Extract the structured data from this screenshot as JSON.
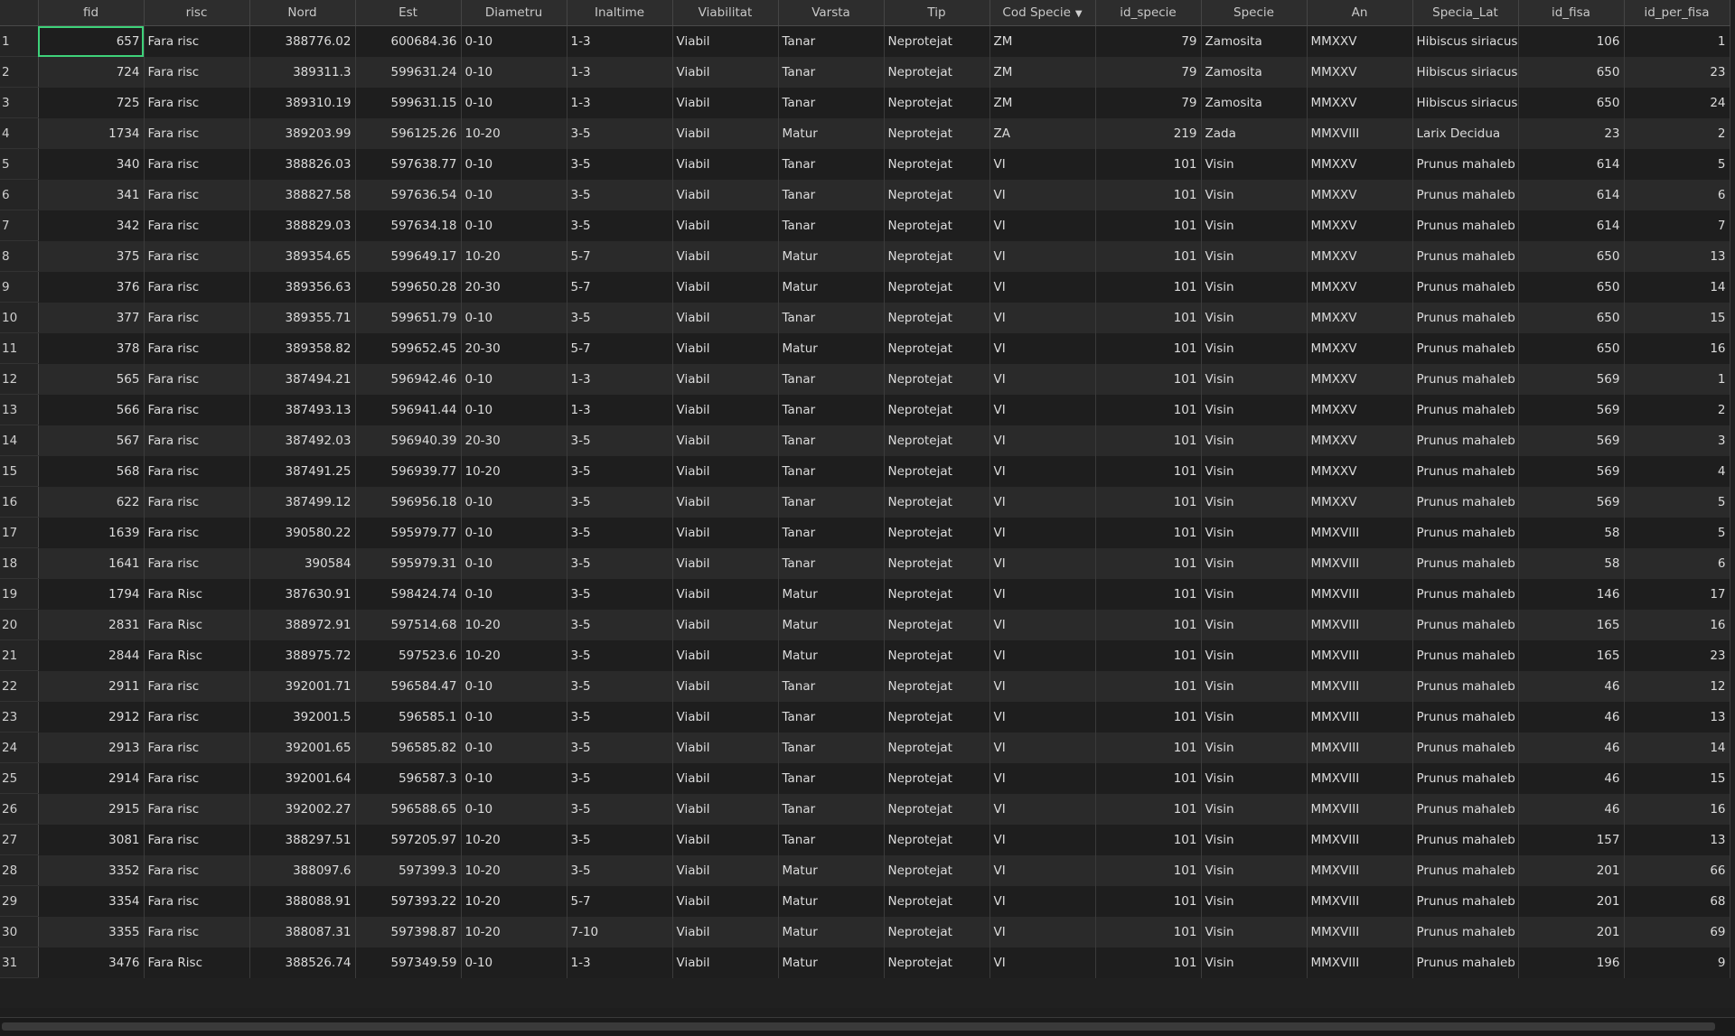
{
  "table": {
    "selected_row": 0,
    "selected_column": "fid",
    "columns": [
      {
        "key": "fid",
        "label": "fid",
        "align": "num"
      },
      {
        "key": "risc",
        "label": "risc",
        "align": "txt"
      },
      {
        "key": "nord",
        "label": "Nord",
        "align": "num"
      },
      {
        "key": "est",
        "label": "Est",
        "align": "num"
      },
      {
        "key": "diametru",
        "label": "Diametru",
        "align": "txt"
      },
      {
        "key": "inaltime",
        "label": "Inaltime",
        "align": "txt"
      },
      {
        "key": "viabilitat",
        "label": "Viabilitat",
        "align": "txt"
      },
      {
        "key": "varsta",
        "label": "Varsta",
        "align": "txt"
      },
      {
        "key": "tip",
        "label": "Tip",
        "align": "txt"
      },
      {
        "key": "cod_specie",
        "label": "Cod Specie",
        "align": "txt",
        "sorted": "desc"
      },
      {
        "key": "id_specie",
        "label": "id_specie",
        "align": "num"
      },
      {
        "key": "specie",
        "label": "Specie",
        "align": "txt"
      },
      {
        "key": "an",
        "label": "An",
        "align": "txt"
      },
      {
        "key": "specia_lat",
        "label": "Specia_Lat",
        "align": "txt"
      },
      {
        "key": "id_fisa",
        "label": "id_fisa",
        "align": "num"
      },
      {
        "key": "id_per_fisa",
        "label": "id_per_fisa",
        "align": "num"
      }
    ],
    "rows": [
      [
        "1",
        "657",
        "Fara risc",
        "388776.02",
        "600684.36",
        "0-10",
        "1-3",
        "Viabil",
        "Tanar",
        "Neprotejat",
        "ZM",
        "79",
        "Zamosita",
        "MMXXV",
        "Hibiscus siriacus",
        "106",
        "1"
      ],
      [
        "2",
        "724",
        "Fara risc",
        "389311.3",
        "599631.24",
        "0-10",
        "1-3",
        "Viabil",
        "Tanar",
        "Neprotejat",
        "ZM",
        "79",
        "Zamosita",
        "MMXXV",
        "Hibiscus siriacus",
        "650",
        "23"
      ],
      [
        "3",
        "725",
        "Fara risc",
        "389310.19",
        "599631.15",
        "0-10",
        "1-3",
        "Viabil",
        "Tanar",
        "Neprotejat",
        "ZM",
        "79",
        "Zamosita",
        "MMXXV",
        "Hibiscus siriacus",
        "650",
        "24"
      ],
      [
        "4",
        "1734",
        "Fara risc",
        "389203.99",
        "596125.26",
        "10-20",
        "3-5",
        "Viabil",
        "Matur",
        "Neprotejat",
        "ZA",
        "219",
        "Zada",
        "MMXVIII",
        "Larix Decidua",
        "23",
        "2"
      ],
      [
        "5",
        "340",
        "Fara risc",
        "388826.03",
        "597638.77",
        "0-10",
        "3-5",
        "Viabil",
        "Tanar",
        "Neprotejat",
        "VI",
        "101",
        "Visin",
        "MMXXV",
        "Prunus mahaleb",
        "614",
        "5"
      ],
      [
        "6",
        "341",
        "Fara risc",
        "388827.58",
        "597636.54",
        "0-10",
        "3-5",
        "Viabil",
        "Tanar",
        "Neprotejat",
        "VI",
        "101",
        "Visin",
        "MMXXV",
        "Prunus mahaleb",
        "614",
        "6"
      ],
      [
        "7",
        "342",
        "Fara risc",
        "388829.03",
        "597634.18",
        "0-10",
        "3-5",
        "Viabil",
        "Tanar",
        "Neprotejat",
        "VI",
        "101",
        "Visin",
        "MMXXV",
        "Prunus mahaleb",
        "614",
        "7"
      ],
      [
        "8",
        "375",
        "Fara risc",
        "389354.65",
        "599649.17",
        "10-20",
        "5-7",
        "Viabil",
        "Matur",
        "Neprotejat",
        "VI",
        "101",
        "Visin",
        "MMXXV",
        "Prunus mahaleb",
        "650",
        "13"
      ],
      [
        "9",
        "376",
        "Fara risc",
        "389356.63",
        "599650.28",
        "20-30",
        "5-7",
        "Viabil",
        "Matur",
        "Neprotejat",
        "VI",
        "101",
        "Visin",
        "MMXXV",
        "Prunus mahaleb",
        "650",
        "14"
      ],
      [
        "10",
        "377",
        "Fara risc",
        "389355.71",
        "599651.79",
        "0-10",
        "3-5",
        "Viabil",
        "Tanar",
        "Neprotejat",
        "VI",
        "101",
        "Visin",
        "MMXXV",
        "Prunus mahaleb",
        "650",
        "15"
      ],
      [
        "11",
        "378",
        "Fara risc",
        "389358.82",
        "599652.45",
        "20-30",
        "5-7",
        "Viabil",
        "Matur",
        "Neprotejat",
        "VI",
        "101",
        "Visin",
        "MMXXV",
        "Prunus mahaleb",
        "650",
        "16"
      ],
      [
        "12",
        "565",
        "Fara risc",
        "387494.21",
        "596942.46",
        "0-10",
        "1-3",
        "Viabil",
        "Tanar",
        "Neprotejat",
        "VI",
        "101",
        "Visin",
        "MMXXV",
        "Prunus mahaleb",
        "569",
        "1"
      ],
      [
        "13",
        "566",
        "Fara risc",
        "387493.13",
        "596941.44",
        "0-10",
        "1-3",
        "Viabil",
        "Tanar",
        "Neprotejat",
        "VI",
        "101",
        "Visin",
        "MMXXV",
        "Prunus mahaleb",
        "569",
        "2"
      ],
      [
        "14",
        "567",
        "Fara risc",
        "387492.03",
        "596940.39",
        "20-30",
        "3-5",
        "Viabil",
        "Tanar",
        "Neprotejat",
        "VI",
        "101",
        "Visin",
        "MMXXV",
        "Prunus mahaleb",
        "569",
        "3"
      ],
      [
        "15",
        "568",
        "Fara risc",
        "387491.25",
        "596939.77",
        "10-20",
        "3-5",
        "Viabil",
        "Tanar",
        "Neprotejat",
        "VI",
        "101",
        "Visin",
        "MMXXV",
        "Prunus mahaleb",
        "569",
        "4"
      ],
      [
        "16",
        "622",
        "Fara risc",
        "387499.12",
        "596956.18",
        "0-10",
        "3-5",
        "Viabil",
        "Tanar",
        "Neprotejat",
        "VI",
        "101",
        "Visin",
        "MMXXV",
        "Prunus mahaleb",
        "569",
        "5"
      ],
      [
        "17",
        "1639",
        "Fara risc",
        "390580.22",
        "595979.77",
        "0-10",
        "3-5",
        "Viabil",
        "Tanar",
        "Neprotejat",
        "VI",
        "101",
        "Visin",
        "MMXVIII",
        "Prunus mahaleb",
        "58",
        "5"
      ],
      [
        "18",
        "1641",
        "Fara risc",
        "390584",
        "595979.31",
        "0-10",
        "3-5",
        "Viabil",
        "Tanar",
        "Neprotejat",
        "VI",
        "101",
        "Visin",
        "MMXVIII",
        "Prunus mahaleb",
        "58",
        "6"
      ],
      [
        "19",
        "1794",
        "Fara Risc",
        "387630.91",
        "598424.74",
        "0-10",
        "3-5",
        "Viabil",
        "Matur",
        "Neprotejat",
        "VI",
        "101",
        "Visin",
        "MMXVIII",
        "Prunus mahaleb",
        "146",
        "17"
      ],
      [
        "20",
        "2831",
        "Fara Risc",
        "388972.91",
        "597514.68",
        "10-20",
        "3-5",
        "Viabil",
        "Matur",
        "Neprotejat",
        "VI",
        "101",
        "Visin",
        "MMXVIII",
        "Prunus mahaleb",
        "165",
        "16"
      ],
      [
        "21",
        "2844",
        "Fara Risc",
        "388975.72",
        "597523.6",
        "10-20",
        "3-5",
        "Viabil",
        "Matur",
        "Neprotejat",
        "VI",
        "101",
        "Visin",
        "MMXVIII",
        "Prunus mahaleb",
        "165",
        "23"
      ],
      [
        "22",
        "2911",
        "Fara risc",
        "392001.71",
        "596584.47",
        "0-10",
        "3-5",
        "Viabil",
        "Tanar",
        "Neprotejat",
        "VI",
        "101",
        "Visin",
        "MMXVIII",
        "Prunus mahaleb",
        "46",
        "12"
      ],
      [
        "23",
        "2912",
        "Fara risc",
        "392001.5",
        "596585.1",
        "0-10",
        "3-5",
        "Viabil",
        "Tanar",
        "Neprotejat",
        "VI",
        "101",
        "Visin",
        "MMXVIII",
        "Prunus mahaleb",
        "46",
        "13"
      ],
      [
        "24",
        "2913",
        "Fara risc",
        "392001.65",
        "596585.82",
        "0-10",
        "3-5",
        "Viabil",
        "Tanar",
        "Neprotejat",
        "VI",
        "101",
        "Visin",
        "MMXVIII",
        "Prunus mahaleb",
        "46",
        "14"
      ],
      [
        "25",
        "2914",
        "Fara risc",
        "392001.64",
        "596587.3",
        "0-10",
        "3-5",
        "Viabil",
        "Tanar",
        "Neprotejat",
        "VI",
        "101",
        "Visin",
        "MMXVIII",
        "Prunus mahaleb",
        "46",
        "15"
      ],
      [
        "26",
        "2915",
        "Fara risc",
        "392002.27",
        "596588.65",
        "0-10",
        "3-5",
        "Viabil",
        "Tanar",
        "Neprotejat",
        "VI",
        "101",
        "Visin",
        "MMXVIII",
        "Prunus mahaleb",
        "46",
        "16"
      ],
      [
        "27",
        "3081",
        "Fara risc",
        "388297.51",
        "597205.97",
        "10-20",
        "3-5",
        "Viabil",
        "Tanar",
        "Neprotejat",
        "VI",
        "101",
        "Visin",
        "MMXVIII",
        "Prunus mahaleb",
        "157",
        "13"
      ],
      [
        "28",
        "3352",
        "Fara risc",
        "388097.6",
        "597399.3",
        "10-20",
        "3-5",
        "Viabil",
        "Matur",
        "Neprotejat",
        "VI",
        "101",
        "Visin",
        "MMXVIII",
        "Prunus mahaleb",
        "201",
        "66"
      ],
      [
        "29",
        "3354",
        "Fara risc",
        "388088.91",
        "597393.22",
        "10-20",
        "5-7",
        "Viabil",
        "Matur",
        "Neprotejat",
        "VI",
        "101",
        "Visin",
        "MMXVIII",
        "Prunus mahaleb",
        "201",
        "68"
      ],
      [
        "30",
        "3355",
        "Fara risc",
        "388087.31",
        "597398.87",
        "10-20",
        "7-10",
        "Viabil",
        "Matur",
        "Neprotejat",
        "VI",
        "101",
        "Visin",
        "MMXVIII",
        "Prunus mahaleb",
        "201",
        "69"
      ],
      [
        "31",
        "3476",
        "Fara Risc",
        "388526.74",
        "597349.59",
        "0-10",
        "1-3",
        "Viabil",
        "Matur",
        "Neprotejat",
        "VI",
        "101",
        "Visin",
        "MMXVIII",
        "Prunus mahaleb",
        "196",
        "9"
      ]
    ]
  }
}
